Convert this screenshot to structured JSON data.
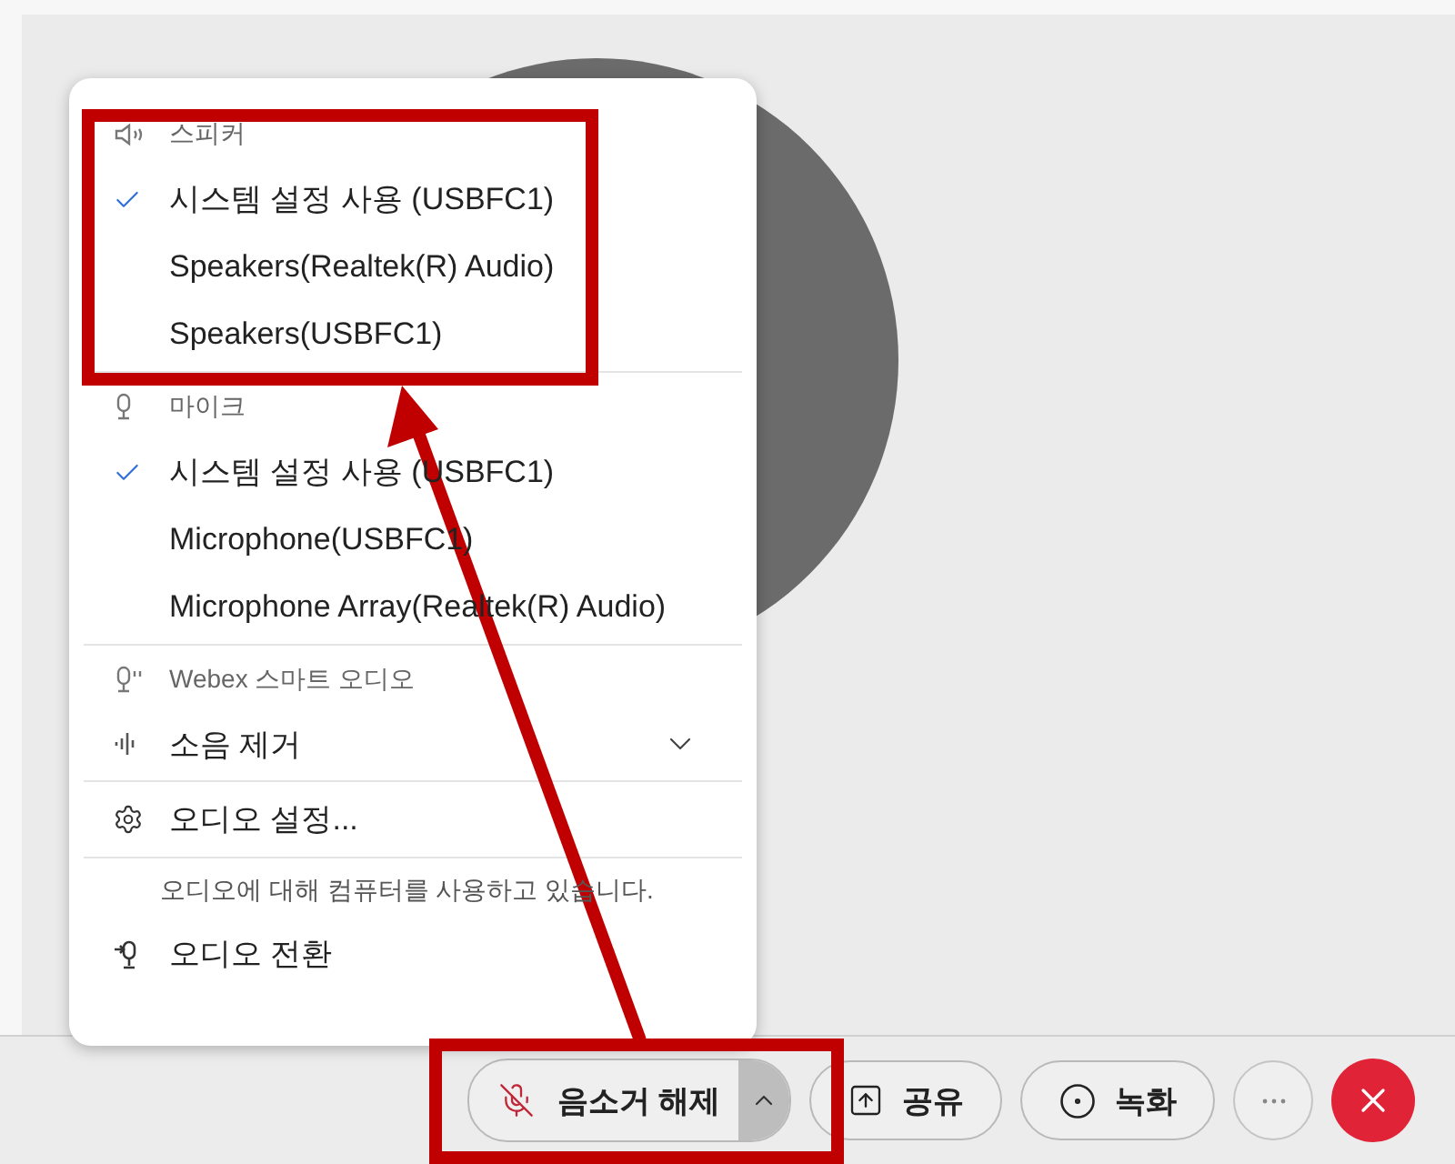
{
  "menu": [
    {
      "kind": "header",
      "label": "스피커"
    },
    {
      "kind": "option",
      "label": "시스템 설정 사용 (USBFC1)",
      "selected": true
    },
    {
      "kind": "option",
      "label": "Speakers(Realtek(R) Audio)",
      "selected": false
    },
    {
      "kind": "option",
      "label": "Speakers(USBFC1)",
      "selected": false
    },
    {
      "kind": "divider"
    },
    {
      "kind": "header",
      "label": "마이크"
    },
    {
      "kind": "option",
      "label": "시스템 설정 사용 (USBFC1)",
      "selected": true
    },
    {
      "kind": "option",
      "label": "Microphone(USBFC1)",
      "selected": false
    },
    {
      "kind": "option",
      "label": "Microphone Array(Realtek(R) Audio)",
      "selected": false
    },
    {
      "kind": "divider"
    },
    {
      "kind": "header",
      "label": "Webex 스마트 오디오"
    },
    {
      "kind": "dropdown",
      "label": "소음 제거",
      "expanded": false
    },
    {
      "kind": "divider"
    },
    {
      "kind": "action",
      "label": "오디오 설정..."
    },
    {
      "kind": "divider"
    },
    {
      "kind": "note",
      "label": "오디오에 대해 컴퓨터를 사용하고 있습니다."
    },
    {
      "kind": "action",
      "label": "오디오 전환"
    }
  ],
  "toolbar": [
    {
      "kind": "mute",
      "label": "음소거 해제",
      "expanded": true
    },
    {
      "kind": "share",
      "label": "공유"
    },
    {
      "kind": "record",
      "label": "녹화"
    },
    {
      "kind": "more"
    },
    {
      "kind": "end"
    }
  ]
}
